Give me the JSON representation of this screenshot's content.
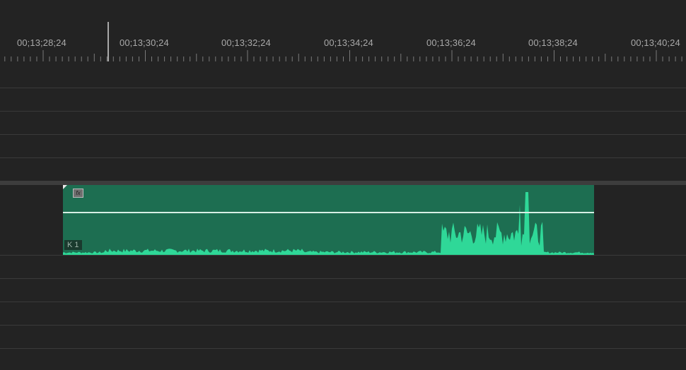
{
  "timeline": {
    "timecodes": [
      "00;13;28;24",
      "00;13;30;24",
      "00;13;32;24",
      "00;13;34;24",
      "00;13;36;24",
      "00;13;38;24",
      "00;13;40;24"
    ]
  },
  "clip": {
    "name": "K 1",
    "fx_badge": "fx",
    "color": "#1d6e51",
    "waveform_color": "#2fd898"
  }
}
